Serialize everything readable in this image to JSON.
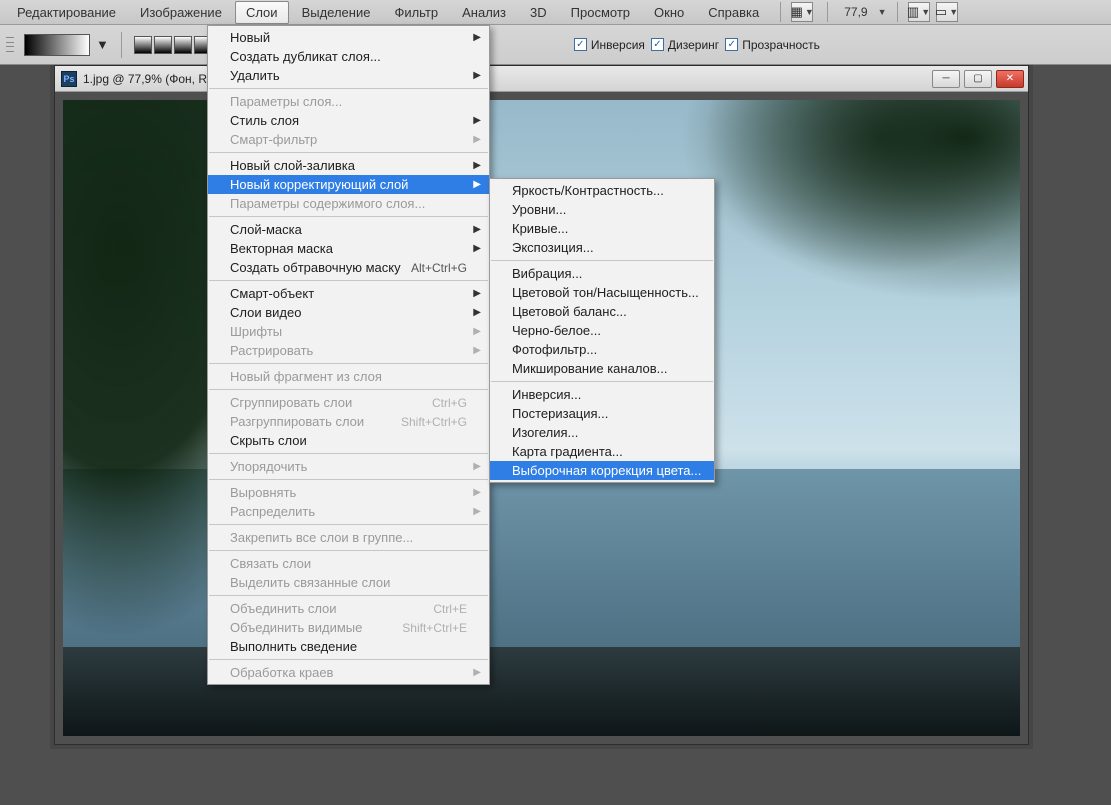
{
  "menubar": {
    "items": [
      "Редактирование",
      "Изображение",
      "Слои",
      "Выделение",
      "Фильтр",
      "Анализ",
      "3D",
      "Просмотр",
      "Окно",
      "Справка"
    ],
    "selected_index": 2,
    "zoom_value": "77,9"
  },
  "optionsbar": {
    "inversion": "Инверсия",
    "dithering": "Дизеринг",
    "transparency": "Прозрачность"
  },
  "document": {
    "title": "1.jpg @ 77,9% (Фон, R"
  },
  "menu_layers": [
    {
      "label": "Новый",
      "arrow": true
    },
    {
      "label": "Создать дубликат слоя..."
    },
    {
      "label": "Удалить",
      "arrow": true
    },
    {
      "sep": true
    },
    {
      "label": "Параметры слоя...",
      "disabled": true
    },
    {
      "label": "Стиль слоя",
      "arrow": true
    },
    {
      "label": "Смарт-фильтр",
      "arrow": true,
      "disabled": true
    },
    {
      "sep": true
    },
    {
      "label": "Новый слой-заливка",
      "arrow": true
    },
    {
      "label": "Новый корректирующий слой",
      "arrow": true,
      "highlight": true
    },
    {
      "label": "Параметры содержимого слоя...",
      "disabled": true
    },
    {
      "sep": true
    },
    {
      "label": "Слой-маска",
      "arrow": true
    },
    {
      "label": "Векторная маска",
      "arrow": true
    },
    {
      "label": "Создать обтравочную маску",
      "shortcut": "Alt+Ctrl+G"
    },
    {
      "sep": true
    },
    {
      "label": "Смарт-объект",
      "arrow": true
    },
    {
      "label": "Слои видео",
      "arrow": true
    },
    {
      "label": "Шрифты",
      "arrow": true,
      "disabled": true
    },
    {
      "label": "Растрировать",
      "arrow": true,
      "disabled": true
    },
    {
      "sep": true
    },
    {
      "label": "Новый фрагмент из слоя",
      "disabled": true
    },
    {
      "sep": true
    },
    {
      "label": "Сгруппировать слои",
      "shortcut": "Ctrl+G",
      "disabled": true
    },
    {
      "label": "Разгруппировать слои",
      "shortcut": "Shift+Ctrl+G",
      "disabled": true
    },
    {
      "label": "Скрыть слои"
    },
    {
      "sep": true
    },
    {
      "label": "Упорядочить",
      "arrow": true,
      "disabled": true
    },
    {
      "sep": true
    },
    {
      "label": "Выровнять",
      "arrow": true,
      "disabled": true
    },
    {
      "label": "Распределить",
      "arrow": true,
      "disabled": true
    },
    {
      "sep": true
    },
    {
      "label": "Закрепить все слои в группе...",
      "disabled": true
    },
    {
      "sep": true
    },
    {
      "label": "Связать слои",
      "disabled": true
    },
    {
      "label": "Выделить связанные слои",
      "disabled": true
    },
    {
      "sep": true
    },
    {
      "label": "Объединить слои",
      "shortcut": "Ctrl+E",
      "disabled": true
    },
    {
      "label": "Объединить видимые",
      "shortcut": "Shift+Ctrl+E",
      "disabled": true
    },
    {
      "label": "Выполнить сведение"
    },
    {
      "sep": true
    },
    {
      "label": "Обработка краев",
      "arrow": true,
      "disabled": true
    }
  ],
  "menu_adjustment": [
    {
      "label": "Яркость/Контрастность..."
    },
    {
      "label": "Уровни..."
    },
    {
      "label": "Кривые..."
    },
    {
      "label": "Экспозиция..."
    },
    {
      "sep": true
    },
    {
      "label": "Вибрация..."
    },
    {
      "label": "Цветовой тон/Насыщенность..."
    },
    {
      "label": "Цветовой баланс..."
    },
    {
      "label": "Черно-белое..."
    },
    {
      "label": "Фотофильтр..."
    },
    {
      "label": "Микширование каналов..."
    },
    {
      "sep": true
    },
    {
      "label": "Инверсия..."
    },
    {
      "label": "Постеризация..."
    },
    {
      "label": "Изогелия..."
    },
    {
      "label": "Карта градиента..."
    },
    {
      "label": "Выборочная коррекция цвета...",
      "highlight": true
    }
  ]
}
